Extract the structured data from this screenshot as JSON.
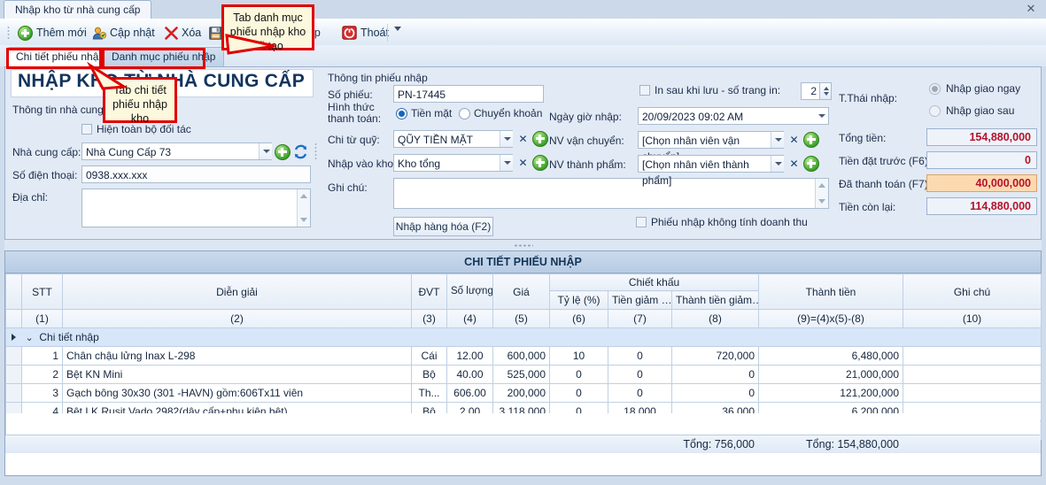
{
  "window": {
    "tab_title": "Nhập kho từ nhà cung cấp",
    "close_icon": "close-icon"
  },
  "toolbar": {
    "add": "Thêm mới",
    "update": "Cập nhật",
    "delete": "Xóa",
    "save_icon": "save-icon",
    "partial_item": "hập",
    "exit": "Thoát",
    "overflow_icon": "chevron-down-icon"
  },
  "tabs": [
    {
      "label": "Chi tiết phiếu nhập",
      "selected": true
    },
    {
      "label": "Danh mục phiếu nhập",
      "selected": false
    }
  ],
  "form": {
    "title": "NHẬP KHO TỪ NHÀ CUNG CẤP",
    "supplier_section": "Thông tin nhà cung cấp",
    "show_all_partners_label": "Hiện toàn bộ đối tác",
    "supplier_label": "Nhà cung cấp:",
    "supplier_value": "Nhà Cung Cấp 73",
    "phone_label": "Số điện thoại:",
    "phone_value": "0938.xxx.xxx",
    "address_label": "Địa chỉ:",
    "address_value": "",
    "receipt_section": "Thông tin phiếu nhập",
    "receipt_no_label": "Số phiếu:",
    "receipt_no_value": "PN-17445",
    "payment_type_label": "Hình thức thanh toán:",
    "payment_cash": "Tiền mặt",
    "payment_transfer": "Chuyển khoản",
    "fund_label": "Chi từ quỹ:",
    "fund_value": "QŨY TIỀN MẶT",
    "warehouse_label": "Nhập vào kho:",
    "warehouse_value": "Kho tổng",
    "note_label": "Ghi chú:",
    "note_value": "",
    "import_goods_btn": "Nhập hàng hóa (F2)",
    "print_after_save_label": "In sau khi lưu - số trang in:",
    "print_pages_value": "2",
    "datetime_label": "Ngày giờ nhập:",
    "datetime_value": "20/09/2023 09:02 AM",
    "shipper_label": "NV vận chuyển:",
    "shipper_value": "[Chọn nhân viên vận chuyển]",
    "product_staff_label": "NV thành phẩm:",
    "product_staff_value": "[Chọn nhân viên thành phẩm]",
    "no_revenue_label": "Phiếu nhập không tính doanh thu",
    "status_label": "T.Thái nhập:",
    "status_now": "Nhập giao ngay",
    "status_later": "Nhập giao sau",
    "total_label": "Tổng tiền:",
    "total_value": "154,880,000",
    "deposit_label": "Tiền đặt trước (F6):",
    "deposit_value": "0",
    "paid_label": "Đã thanh toán (F7):",
    "paid_value": "40,000,000",
    "remaining_label": "Tiền còn lại:",
    "remaining_value": "114,880,000"
  },
  "grid": {
    "caption": "CHI TIẾT PHIẾU NHẬP",
    "headers": {
      "stt": "STT",
      "desc": "Diễn giải",
      "unit": "ĐVT",
      "qty": "Số lượng",
      "price": "Giá",
      "discount_group": "Chiết khấu",
      "disc_rate": "Tỷ lệ (%)",
      "disc_amount": "Tiền giảm …",
      "disc_total": "Thành tiền giảm…",
      "amount": "Thành tiền",
      "note": "Ghi chú"
    },
    "numbering": [
      "(1)",
      "(2)",
      "(3)",
      "(4)",
      "(5)",
      "(6)",
      "(7)",
      "(8)",
      "(9)=(4)x(5)-(8)",
      "(10)"
    ],
    "group_label": "Chi tiết nhập",
    "rows": [
      {
        "stt": "1",
        "desc": "Chân chậu lửng Inax L-298",
        "unit": "Cái",
        "qty": "12.00",
        "price": "600,000",
        "disc_rate": "10",
        "disc_amount": "0",
        "disc_total": "720,000",
        "amount": "6,480,000",
        "note": ""
      },
      {
        "stt": "2",
        "desc": "Bệt KN Mini",
        "unit": "Bộ",
        "qty": "40.00",
        "price": "525,000",
        "disc_rate": "0",
        "disc_amount": "0",
        "disc_total": "0",
        "amount": "21,000,000",
        "note": ""
      },
      {
        "stt": "3",
        "desc": "Gạch bông 30x30 (301 -HAVN) gồm:606Tx11 viên",
        "unit": "Th...",
        "qty": "606.00",
        "price": "200,000",
        "disc_rate": "0",
        "disc_amount": "0",
        "disc_total": "0",
        "amount": "121,200,000",
        "note": ""
      },
      {
        "stt": "4",
        "desc": "Bệt LK Rusit Vado 2982(dây cấp+phụ kiện bệt)",
        "unit": "Bộ",
        "qty": "2.00",
        "price": "3,118,000",
        "disc_rate": "0",
        "disc_amount": "18,000",
        "disc_total": "36,000",
        "amount": "6,200,000",
        "note": ""
      }
    ],
    "summary": {
      "disc_total": "=756,000",
      "amount": "=154,880,000"
    },
    "footer": {
      "disc_total": "Tổng: 756,000",
      "amount": "Tổng: 154,880,000"
    }
  },
  "callouts": [
    {
      "text": "Tab danh mục phiếu nhập kho đã tạo"
    },
    {
      "text": "Tab chi tiết phiếu nhập kho"
    }
  ],
  "colors": {
    "accent": "#12355e",
    "money": "#b5122a",
    "callout_border": "#e00000",
    "callout_bg": "#fbf8dd",
    "highlight_field": "#fdd9b0"
  }
}
